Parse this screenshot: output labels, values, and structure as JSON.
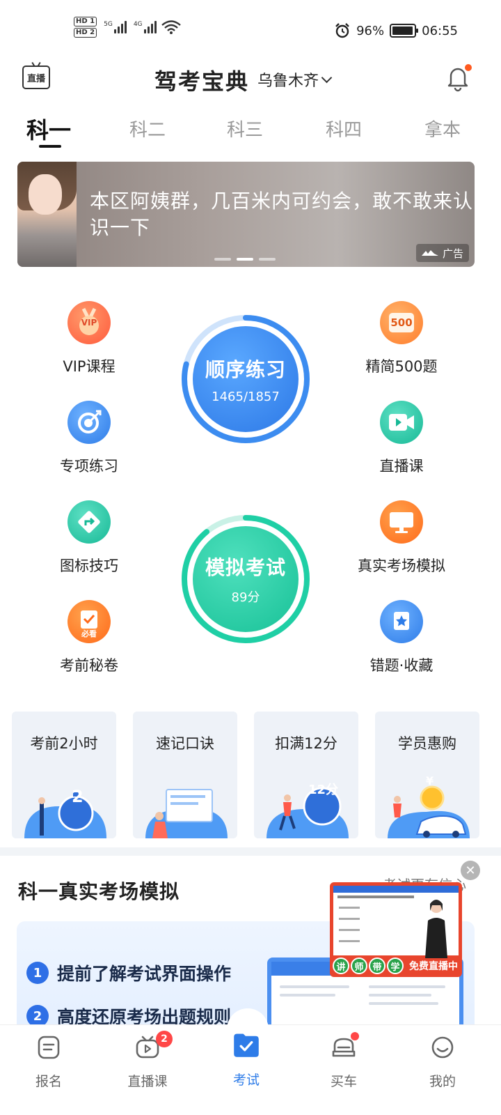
{
  "status_bar": {
    "hd1": "HD 1",
    "hd2": "HD 2",
    "net1": "5G",
    "net2": "4G",
    "battery": "96%",
    "battery_level": 0.96,
    "time": "06:55"
  },
  "header": {
    "live_label": "直播",
    "title": "驾考宝典",
    "city": "乌鲁木齐"
  },
  "tabs": [
    "科一",
    "科二",
    "科三",
    "科四",
    "拿本"
  ],
  "banner": {
    "text": "本区阿姨群，几百米内可约会，敢不敢来认识一下",
    "ad_label": "广告"
  },
  "features": {
    "vip": "VIP课程",
    "jingjian": "精简500题",
    "zhuanxiang": "专项练习",
    "zhibo": "直播课",
    "tubiao": "图标技巧",
    "zhenshi": "真实考场模拟",
    "kaoqian": "考前秘卷",
    "cuoti": "错题·收藏",
    "vip_badge": "VIP",
    "jingjian_badge": "500",
    "kaoqian_badge": "必看"
  },
  "practice": {
    "title": "顺序练习",
    "progress": "1465/1857",
    "progress_fraction": 0.789
  },
  "exam": {
    "title": "模拟考试",
    "score": "89分",
    "score_fraction": 0.89
  },
  "cards": [
    {
      "title": "考前2小时",
      "badge": "2"
    },
    {
      "title": "速记口诀",
      "badge": ""
    },
    {
      "title": "扣满12分",
      "badge": "12分"
    },
    {
      "title": "学员惠购",
      "badge": "¥"
    }
  ],
  "section": {
    "title": "科一真实考场模拟",
    "more": "考试更有信心",
    "bullets": [
      {
        "num": "1",
        "text": "提前了解考试界面操作"
      },
      {
        "num": "2",
        "text": "高度还原考场出题规则"
      }
    ]
  },
  "float_video": {
    "chars": [
      "讲",
      "师",
      "带",
      "学"
    ],
    "live": "免费直播中"
  },
  "bottom_nav": [
    {
      "label": "报名",
      "badge": ""
    },
    {
      "label": "直播课",
      "badge": "2"
    },
    {
      "label": "考试",
      "badge": ""
    },
    {
      "label": "买车",
      "badge": ""
    },
    {
      "label": "我的",
      "badge": ""
    }
  ],
  "colors": {
    "accent_blue": "#2e7ce8",
    "accent_green": "#20c9a3",
    "notify_red": "#ff4747"
  }
}
